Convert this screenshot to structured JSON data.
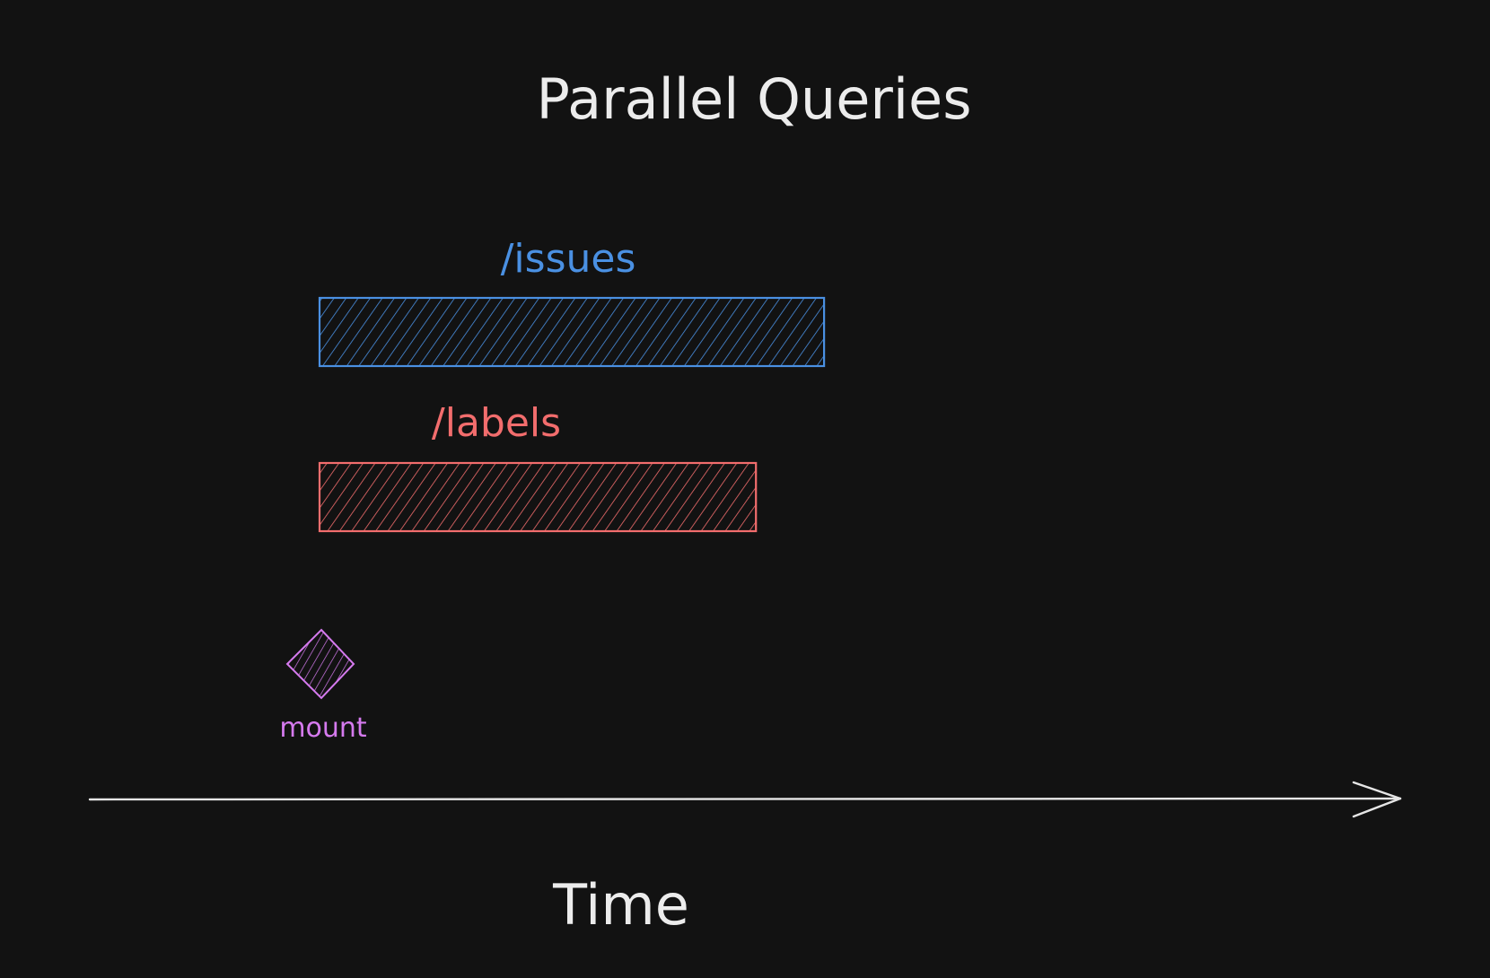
{
  "title": "Parallel Queries",
  "colors": {
    "background": "#121212",
    "text": "#ececec",
    "issues": "#4a90e2",
    "labels": "#f26d6d",
    "mount": "#d57aee",
    "axis": "#e6e6e6"
  },
  "queries": [
    {
      "label": "/issues",
      "color_key": "issues",
      "start": 0,
      "end": 0.385
    },
    {
      "label": "/labels",
      "color_key": "labels",
      "start": 0,
      "end": 0.333
    }
  ],
  "event": {
    "label": "mount",
    "color_key": "mount",
    "at": 0
  },
  "axis": {
    "label": "Time",
    "icon": "arrow-right-icon"
  }
}
